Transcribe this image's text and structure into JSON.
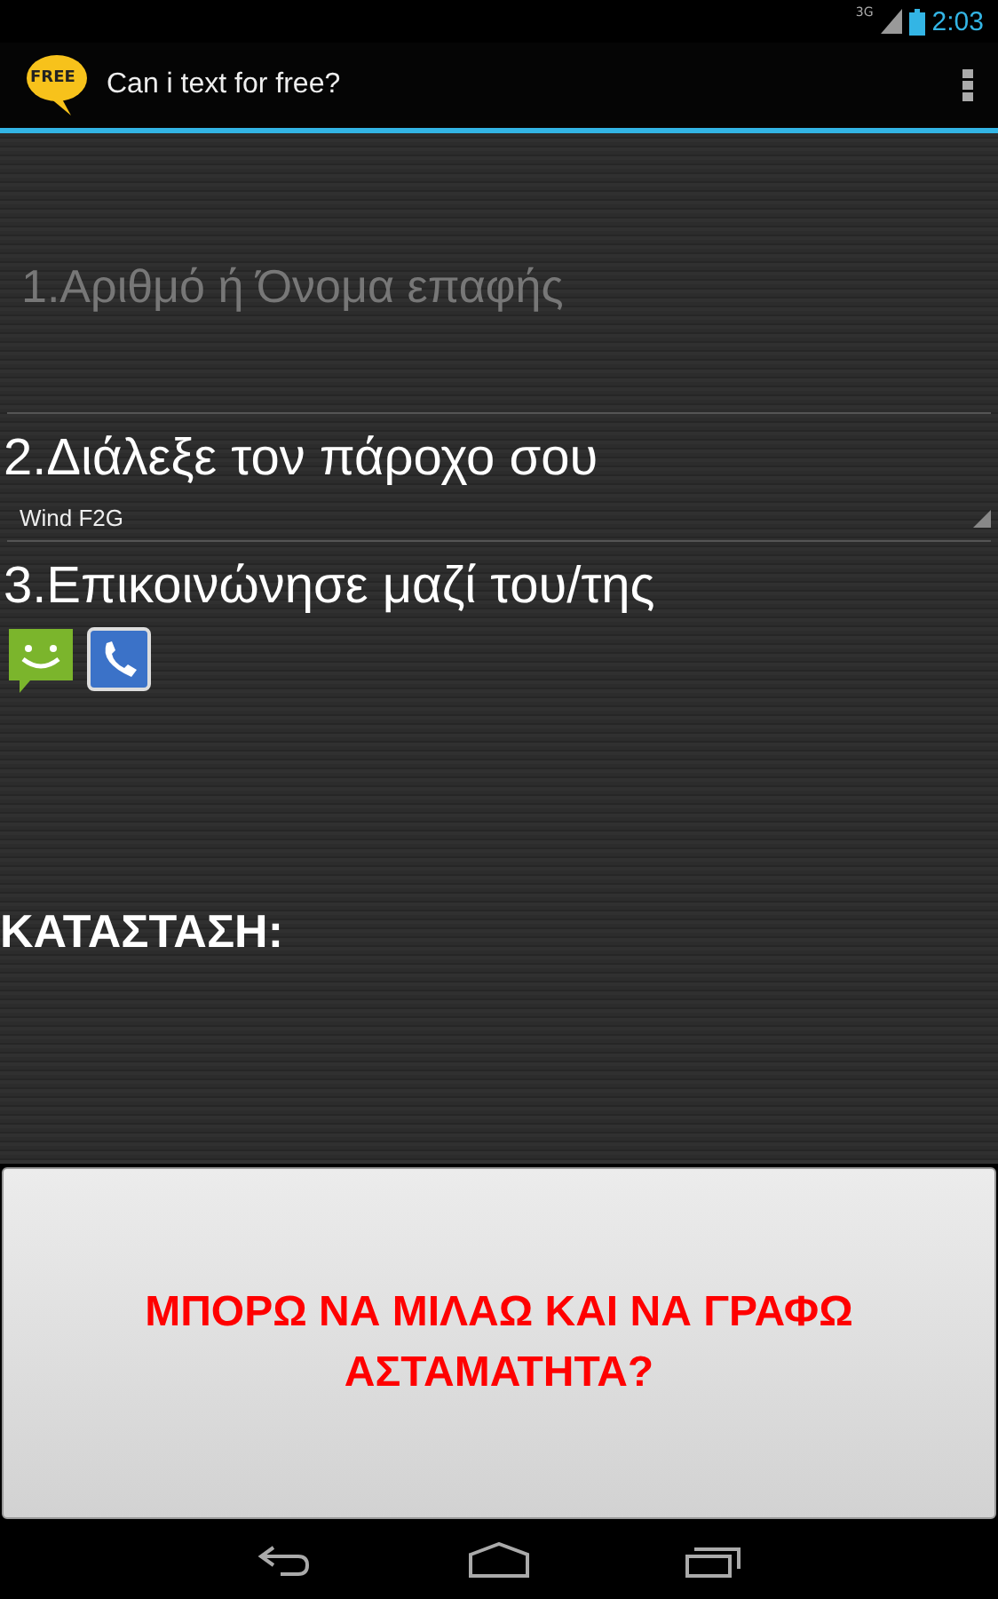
{
  "status_bar": {
    "network": "3G",
    "time": "2:03"
  },
  "action_bar": {
    "logo_text": "FREE",
    "title": "Can i text for free?"
  },
  "contact_field": {
    "placeholder": "1.Αριθμό ή Όνομα επαφής"
  },
  "provider_heading": "2.Διάλεξε τον πάροχο σου",
  "provider_select": {
    "value": "Wind F2G"
  },
  "contact_heading": "3.Επικοινώνησε μαζί του/της",
  "status_label": "ΚΑΤΑΣΤΑΣΗ:",
  "main_button": "ΜΠΟΡΩ ΝΑ ΜΙΛΑΩ ΚΑΙ ΝΑ ΓΡΑΦΩ ΑΣΤΑΜΑΤΗΤΑ?"
}
